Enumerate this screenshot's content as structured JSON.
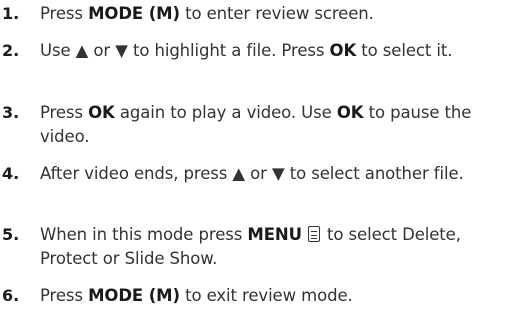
{
  "steps": [
    {
      "number": "1.",
      "parts": [
        {
          "t": "Press ",
          "b": false
        },
        {
          "t": "MODE (M)",
          "b": true
        },
        {
          "t": " to enter review screen.",
          "b": false
        }
      ]
    },
    {
      "number": "2.",
      "parts": [
        {
          "t": "Use ▲ or ▼ to highlight a file. Press ",
          "b": false
        },
        {
          "t": "OK",
          "b": true
        },
        {
          "t": " to select it.",
          "b": false
        }
      ]
    },
    {
      "number": "3.",
      "parts": [
        {
          "t": "Press ",
          "b": false
        },
        {
          "t": "OK",
          "b": true
        },
        {
          "t": " again to play a video. Use ",
          "b": false
        },
        {
          "t": "OK",
          "b": true
        },
        {
          "t": " to pause the video.",
          "b": false
        }
      ]
    },
    {
      "number": "4.",
      "parts": [
        {
          "t": "After video ends, press ▲ or ▼ to select another file.",
          "b": false
        }
      ]
    },
    {
      "number": "5.",
      "parts": [
        {
          "t": "When in this mode press ",
          "b": false
        },
        {
          "t": "MENU",
          "b": true
        },
        {
          "icon": "menu-icon"
        },
        {
          "t": " to select Delete, Protect or Slide Show.",
          "b": false
        }
      ]
    },
    {
      "number": "6.",
      "parts": [
        {
          "t": "Press ",
          "b": false
        },
        {
          "t": "MODE (M)",
          "b": true
        },
        {
          "t": " to exit review mode.",
          "b": false
        }
      ]
    }
  ]
}
